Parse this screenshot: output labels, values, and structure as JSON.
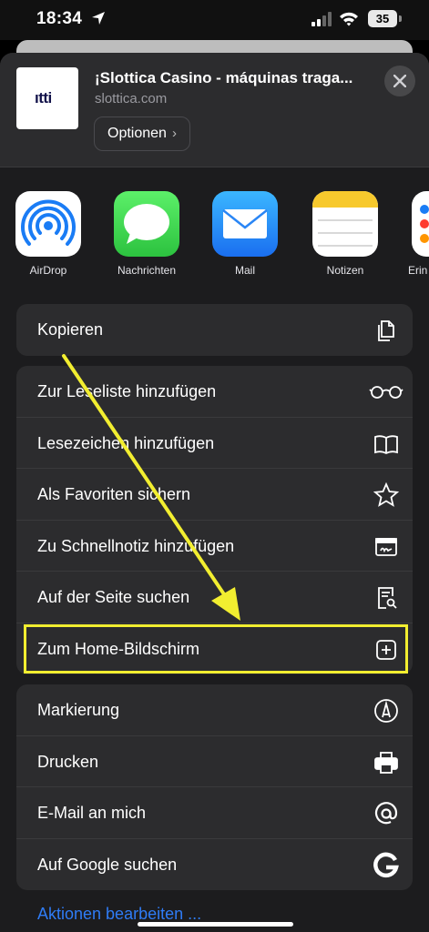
{
  "status_bar": {
    "time": "18:34",
    "battery": "35"
  },
  "share_sheet": {
    "title": "¡Slottica Casino - máquinas traga...",
    "url": "slottica.com",
    "thumbnail_text": "ıtti",
    "options_label": "Optionen",
    "options_chevron": "›"
  },
  "apps": [
    {
      "label": "AirDrop",
      "icon": "airdrop-icon"
    },
    {
      "label": "Nachrichten",
      "icon": "messages-icon"
    },
    {
      "label": "Mail",
      "icon": "mail-icon"
    },
    {
      "label": "Notizen",
      "icon": "notes-icon"
    },
    {
      "label": "Erin",
      "icon": "reminders-icon"
    }
  ],
  "actions": {
    "group1": [
      {
        "label": "Kopieren",
        "icon": "copy-icon"
      }
    ],
    "group2": [
      {
        "label": "Zur Leseliste hinzufügen",
        "icon": "glasses-icon"
      },
      {
        "label": "Lesezeichen hinzufügen",
        "icon": "book-icon"
      },
      {
        "label": "Als Favoriten sichern",
        "icon": "star-icon"
      },
      {
        "label": "Zu Schnellnotiz hinzufügen",
        "icon": "quick-note-icon"
      },
      {
        "label": "Auf der Seite suchen",
        "icon": "find-on-page-icon"
      },
      {
        "label": "Zum Home-Bildschirm",
        "icon": "add-square-icon"
      }
    ],
    "group3": [
      {
        "label": "Markierung",
        "icon": "markup-icon"
      },
      {
        "label": "Drucken",
        "icon": "printer-icon"
      },
      {
        "label": "E-Mail an mich",
        "icon": "at-icon"
      },
      {
        "label": "Auf Google suchen",
        "icon": "google-icon"
      }
    ]
  },
  "edit_actions_label": "Aktionen bearbeiten ...",
  "colors": {
    "highlight": "#f2ee30",
    "link": "#2f7cf6"
  }
}
